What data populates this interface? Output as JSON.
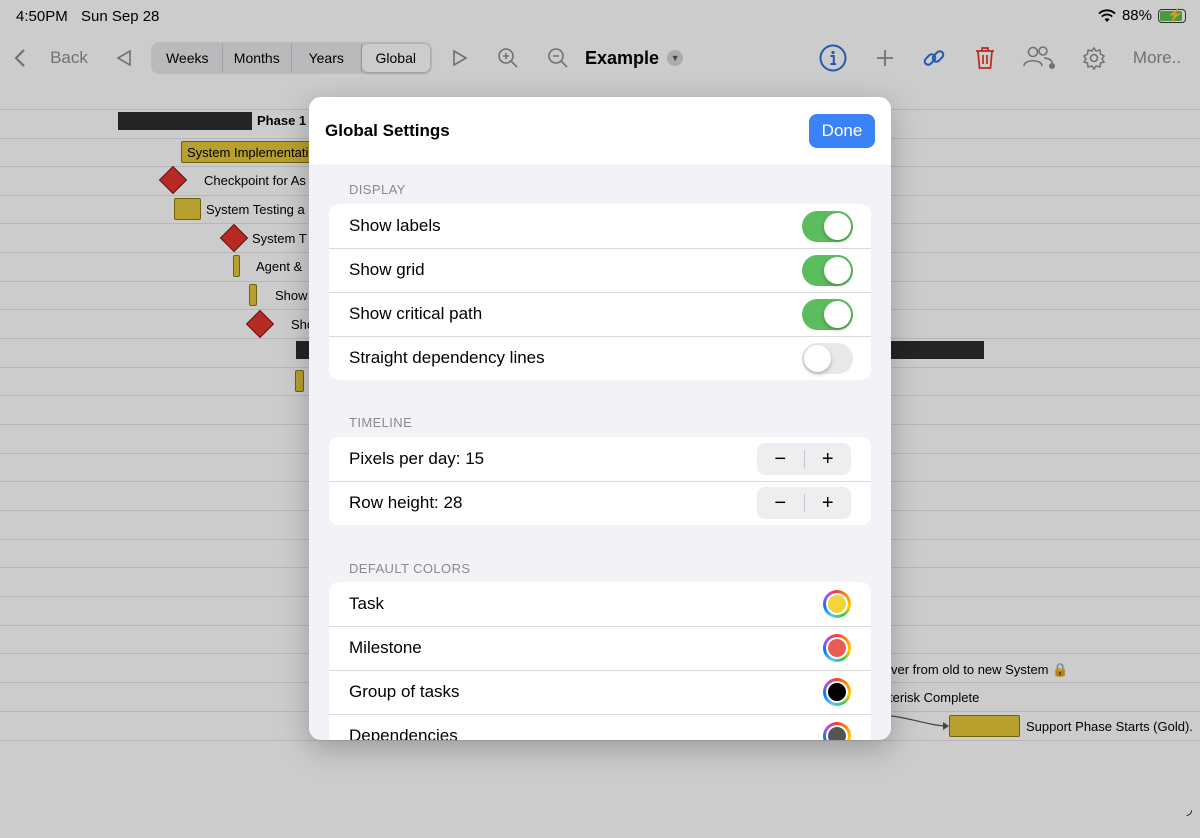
{
  "status_bar": {
    "time": "4:50PM",
    "date": "Sun Sep 28",
    "battery": "88%"
  },
  "toolbar": {
    "back_label": "Back",
    "segments": [
      "Weeks",
      "Months",
      "Years",
      "Global"
    ],
    "active_segment": "Global",
    "document_title": "Example",
    "more_label": "More.."
  },
  "gantt": {
    "labels": {
      "phase1": "Phase 1",
      "system_impl": "System Implementati",
      "checkpoint": "Checkpoint for As",
      "system_testing": "System Testing a",
      "system_t": "System T",
      "agent": "Agent &",
      "show1": "Show",
      "show2": "Sho",
      "cutover": "ver from old to new System",
      "asterisk": "terisk Complete",
      "support": "Support Phase Starts (Gold)."
    }
  },
  "settings": {
    "title": "Global Settings",
    "done_label": "Done",
    "display": {
      "header": "DISPLAY",
      "rows": [
        {
          "label": "Show labels",
          "on": true
        },
        {
          "label": "Show grid",
          "on": true
        },
        {
          "label": "Show critical path",
          "on": true
        },
        {
          "label": "Straight dependency lines",
          "on": false
        }
      ]
    },
    "timeline": {
      "header": "TIMELINE",
      "pixels_per_day": "Pixels per day: 15",
      "row_height": "Row height: 28",
      "minus": "−",
      "plus": "+"
    },
    "default_colors": {
      "header": "DEFAULT COLORS",
      "rows": [
        {
          "label": "Task",
          "color": "#f2d53c"
        },
        {
          "label": "Milestone",
          "color": "#ea5b55"
        },
        {
          "label": "Group of tasks",
          "color": "#000000"
        },
        {
          "label": "Dependencies",
          "color": "#555555"
        }
      ]
    }
  },
  "colors": {
    "accent": "#3b82f6",
    "switch_on": "#5bbd5e"
  }
}
